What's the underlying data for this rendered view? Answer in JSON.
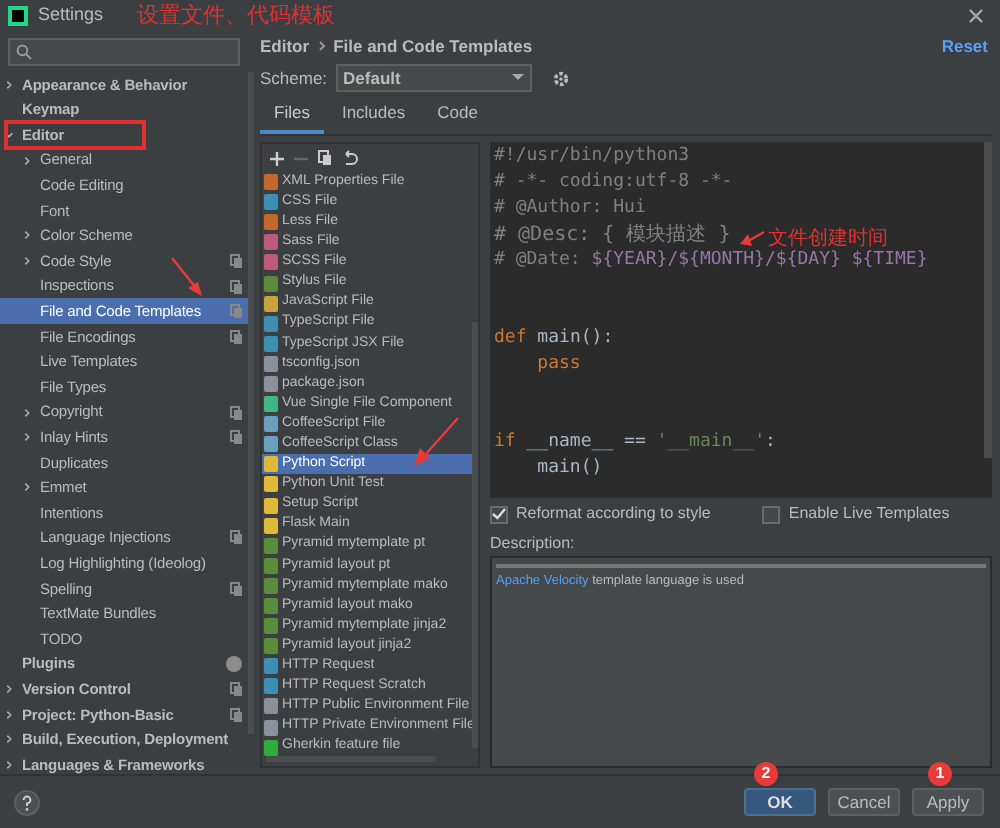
{
  "window": {
    "title": "Settings"
  },
  "tree": [
    {
      "label": "Appearance & Behavior",
      "bold": true,
      "expanded": false,
      "selected": false,
      "project_level": false
    },
    {
      "label": "Keymap",
      "bold": true,
      "selected": false,
      "project_level": false
    },
    {
      "label": "Editor",
      "bold": true,
      "expanded": true,
      "selected": false,
      "project_level": false,
      "children": [
        {
          "label": "General",
          "expanded": false,
          "selected": false,
          "project_level": false
        },
        {
          "label": "Code Editing",
          "selected": false,
          "project_level": false
        },
        {
          "label": "Font",
          "selected": false,
          "project_level": false
        },
        {
          "label": "Color Scheme",
          "expanded": false,
          "selected": false,
          "project_level": false
        },
        {
          "label": "Code Style",
          "expanded": false,
          "selected": false,
          "project_level": true
        },
        {
          "label": "Inspections",
          "selected": false,
          "project_level": true
        },
        {
          "label": "File and Code Templates",
          "selected": true,
          "project_level": true
        },
        {
          "label": "File Encodings",
          "selected": false,
          "project_level": true
        },
        {
          "label": "Live Templates",
          "selected": false,
          "project_level": false
        },
        {
          "label": "File Types",
          "selected": false,
          "project_level": false
        },
        {
          "label": "Copyright",
          "expanded": false,
          "selected": false,
          "project_level": true
        },
        {
          "label": "Inlay Hints",
          "expanded": false,
          "selected": false,
          "project_level": true
        },
        {
          "label": "Duplicates",
          "selected": false,
          "project_level": false
        },
        {
          "label": "Emmet",
          "expanded": false,
          "selected": false,
          "project_level": false
        },
        {
          "label": "Intentions",
          "selected": false,
          "project_level": false
        },
        {
          "label": "Language Injections",
          "selected": false,
          "project_level": true
        },
        {
          "label": "Log Highlighting (Ideolog)",
          "selected": false,
          "project_level": false
        },
        {
          "label": "Spelling",
          "selected": false,
          "project_level": true
        },
        {
          "label": "TextMate Bundles",
          "selected": false,
          "project_level": false
        },
        {
          "label": "TODO",
          "selected": false,
          "project_level": false
        }
      ]
    },
    {
      "label": "Plugins",
      "bold": true,
      "selected": false,
      "project_level": false,
      "badge": true
    },
    {
      "label": "Version Control",
      "bold": true,
      "expanded": false,
      "selected": false,
      "project_level": true
    },
    {
      "label": "Project: Python-Basic",
      "bold": true,
      "expanded": false,
      "selected": false,
      "project_level": true
    },
    {
      "label": "Build, Execution, Deployment",
      "bold": true,
      "expanded": false,
      "selected": false,
      "project_level": false
    },
    {
      "label": "Languages & Frameworks",
      "bold": true,
      "expanded": false,
      "selected": false,
      "project_level": false
    }
  ],
  "breadcrumb": [
    "Editor",
    "File and Code Templates"
  ],
  "reset_link": "Reset",
  "scheme": {
    "label": "Scheme:",
    "value": "Default"
  },
  "tabs": [
    {
      "label": "Files",
      "selected": true
    },
    {
      "label": "Includes",
      "selected": false
    },
    {
      "label": "Code",
      "selected": false
    }
  ],
  "templates": [
    {
      "label": "XML Properties File",
      "color": "#c4692b",
      "selected": false
    },
    {
      "label": "CSS File",
      "color": "#3d8fb5",
      "selected": false
    },
    {
      "label": "Less File",
      "color": "#c4692b",
      "selected": false
    },
    {
      "label": "Sass File",
      "color": "#c05a7a",
      "selected": false
    },
    {
      "label": "SCSS File",
      "color": "#c05a7a",
      "selected": false
    },
    {
      "label": "Stylus File",
      "color": "#5b8c3a",
      "selected": false
    },
    {
      "label": "JavaScript File",
      "color": "#c9a23c",
      "selected": false
    },
    {
      "label": "TypeScript File",
      "color": "#3d8fb5",
      "selected": false
    },
    {
      "label": "TypeScript JSX File",
      "color": "#3d8fb5",
      "selected": false
    },
    {
      "label": "tsconfig.json",
      "color": "#8a9199",
      "selected": false
    },
    {
      "label": "package.json",
      "color": "#8a9199",
      "selected": false
    },
    {
      "label": "Vue Single File Component",
      "color": "#41b883",
      "selected": false
    },
    {
      "label": "CoffeeScript File",
      "color": "#6a9fc0",
      "selected": false
    },
    {
      "label": "CoffeeScript Class",
      "color": "#6a9fc0",
      "selected": false
    },
    {
      "label": "Python Script",
      "color": "#e0b83a",
      "selected": true
    },
    {
      "label": "Python Unit Test",
      "color": "#e0b83a",
      "selected": false
    },
    {
      "label": "Setup Script",
      "color": "#e0b83a",
      "selected": false
    },
    {
      "label": "Flask Main",
      "color": "#e0b83a",
      "selected": false
    },
    {
      "label": "Pyramid mytemplate pt",
      "color": "#5b8c3a",
      "selected": false
    },
    {
      "label": "Pyramid layout pt",
      "color": "#5b8c3a",
      "selected": false
    },
    {
      "label": "Pyramid mytemplate mako",
      "color": "#5b8c3a",
      "selected": false
    },
    {
      "label": "Pyramid layout mako",
      "color": "#5b8c3a",
      "selected": false
    },
    {
      "label": "Pyramid mytemplate jinja2",
      "color": "#5b8c3a",
      "selected": false
    },
    {
      "label": "Pyramid layout jinja2",
      "color": "#5b8c3a",
      "selected": false
    },
    {
      "label": "HTTP Request",
      "color": "#3d8fb5",
      "selected": false
    },
    {
      "label": "HTTP Request Scratch",
      "color": "#3d8fb5",
      "selected": false
    },
    {
      "label": "HTTP Public Environment File",
      "color": "#8a9199",
      "selected": false
    },
    {
      "label": "HTTP Private Environment File",
      "color": "#8a9199",
      "selected": false
    },
    {
      "label": "Gherkin feature file",
      "color": "#2fae3c",
      "selected": false
    }
  ],
  "code": [
    {
      "kind": "code",
      "segments": [
        {
          "kind": "comment",
          "text": "#!/usr/bin/python3"
        }
      ]
    },
    {
      "kind": "code",
      "segments": [
        {
          "kind": "comment",
          "text": "# -*- coding:utf-8 -*-"
        }
      ]
    },
    {
      "kind": "code",
      "segments": [
        {
          "kind": "comment",
          "text": "# @Author: Hui"
        }
      ]
    },
    {
      "kind": "code",
      "segments": [
        {
          "kind": "comment",
          "text": "# @Desc: { 模块描述 }"
        }
      ]
    },
    {
      "kind": "code",
      "segments": [
        {
          "kind": "comment",
          "text": "# @Date: "
        },
        {
          "kind": "var",
          "text": "${YEAR}/${MONTH}/${DAY} ${TIME}"
        }
      ]
    },
    {
      "kind": "blank"
    },
    {
      "kind": "blank"
    },
    {
      "kind": "code",
      "segments": [
        {
          "kind": "keyword",
          "text": "def"
        },
        {
          "kind": "plain",
          "text": " main():"
        }
      ]
    },
    {
      "kind": "code",
      "segments": [
        {
          "kind": "keyword",
          "text": "    pass"
        }
      ]
    },
    {
      "kind": "blank"
    },
    {
      "kind": "blank"
    },
    {
      "kind": "code",
      "segments": [
        {
          "kind": "keyword",
          "text": "if"
        },
        {
          "kind": "plain",
          "text": " __name__ == "
        },
        {
          "kind": "string",
          "text": "'__main__'"
        },
        {
          "kind": "plain",
          "text": ":"
        }
      ]
    },
    {
      "kind": "code",
      "segments": [
        {
          "kind": "plain",
          "text": "    main()"
        }
      ]
    }
  ],
  "options": [
    {
      "label": "Reformat according to style",
      "checked": true
    },
    {
      "label": "Enable Live Templates",
      "checked": false
    }
  ],
  "description": {
    "label": "Description:",
    "link": "Apache Velocity",
    "text": " template language is used"
  },
  "buttons": [
    {
      "label": "OK",
      "primary": true
    },
    {
      "label": "Cancel",
      "primary": false
    },
    {
      "label": "Apply",
      "primary": false
    }
  ],
  "annotations": {
    "title_note": "设置文件、代码模板",
    "date_note": "文件创建时间",
    "badges": [
      "2",
      "1"
    ]
  }
}
